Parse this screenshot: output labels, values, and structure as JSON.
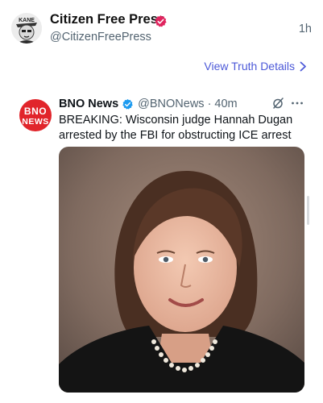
{
  "truth": {
    "avatar_icon": "kane-caricature-avatar",
    "avatar_text": "KANE",
    "display_name": "Citizen Free Press",
    "verified_icon": "red-verified-badge-icon",
    "handle": "@CitizenFreePress",
    "time_ago": "1h",
    "view_details_label": "View Truth Details",
    "colors": {
      "accent": "#4c59d8",
      "verified": "#e0245e"
    }
  },
  "quoted_tweet": {
    "logo_text_top": "BNO",
    "logo_text_bottom": "NEWS",
    "logo_color": "#e1252b",
    "name": "BNO News",
    "verified_icon": "blue-verified-check-icon",
    "handle_time": "@BNONews · 40m",
    "text": "BREAKING: Wisconsin judge Hannah Dugan arrested by the FBI for obstructing ICE arrest",
    "photo_icon": "portrait-photo",
    "icons": [
      "grok-icon",
      "more-icon"
    ],
    "colors": {
      "verified": "#1d9bf0"
    }
  }
}
